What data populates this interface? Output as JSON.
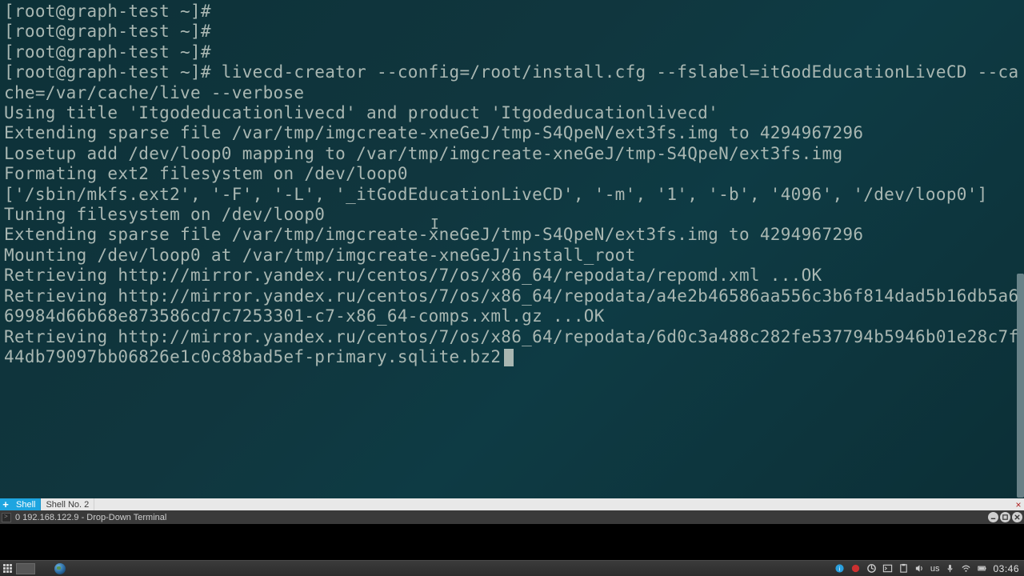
{
  "terminal": {
    "prompt": "[root@graph-test ~]#",
    "command": "livecd-creator --config=/root/install.cfg --fslabel=itGodEducationLiveCD --cache=/var/cache/live --verbose",
    "output_lines": [
      "Using title 'Itgodeducationlivecd' and product 'Itgodeducationlivecd'",
      "Extending sparse file /var/tmp/imgcreate-xneGeJ/tmp-S4QpeN/ext3fs.img to 4294967296",
      "Losetup add /dev/loop0 mapping to /var/tmp/imgcreate-xneGeJ/tmp-S4QpeN/ext3fs.img",
      "Formating ext2 filesystem on /dev/loop0",
      "['/sbin/mkfs.ext2', '-F', '-L', '_itGodEducationLiveCD', '-m', '1', '-b', '4096', '/dev/loop0']",
      "Tuning filesystem on /dev/loop0",
      "Extending sparse file /var/tmp/imgcreate-xneGeJ/tmp-S4QpeN/ext3fs.img to 4294967296",
      "Mounting /dev/loop0 at /var/tmp/imgcreate-xneGeJ/install_root",
      "Retrieving http://mirror.yandex.ru/centos/7/os/x86_64/repodata/repomd.xml ...OK",
      "Retrieving http://mirror.yandex.ru/centos/7/os/x86_64/repodata/a4e2b46586aa556c3b6f814dad5b16db5a669984d66b68e873586cd7c7253301-c7-x86_64-comps.xml.gz ...OK",
      "Retrieving http://mirror.yandex.ru/centos/7/os/x86_64/repodata/6d0c3a488c282fe537794b5946b01e28c7f44db79097bb06826e1c0c88bad5ef-primary.sqlite.bz2"
    ]
  },
  "tabs": {
    "new": "+",
    "items": [
      {
        "label": "Shell",
        "active": true
      },
      {
        "label": "Shell No. 2",
        "active": false
      }
    ],
    "close": "×"
  },
  "titlebar": {
    "text": "0 192.168.122.9 - Drop-Down Terminal"
  },
  "panel": {
    "keyboard": "us",
    "clock": "03:46"
  }
}
